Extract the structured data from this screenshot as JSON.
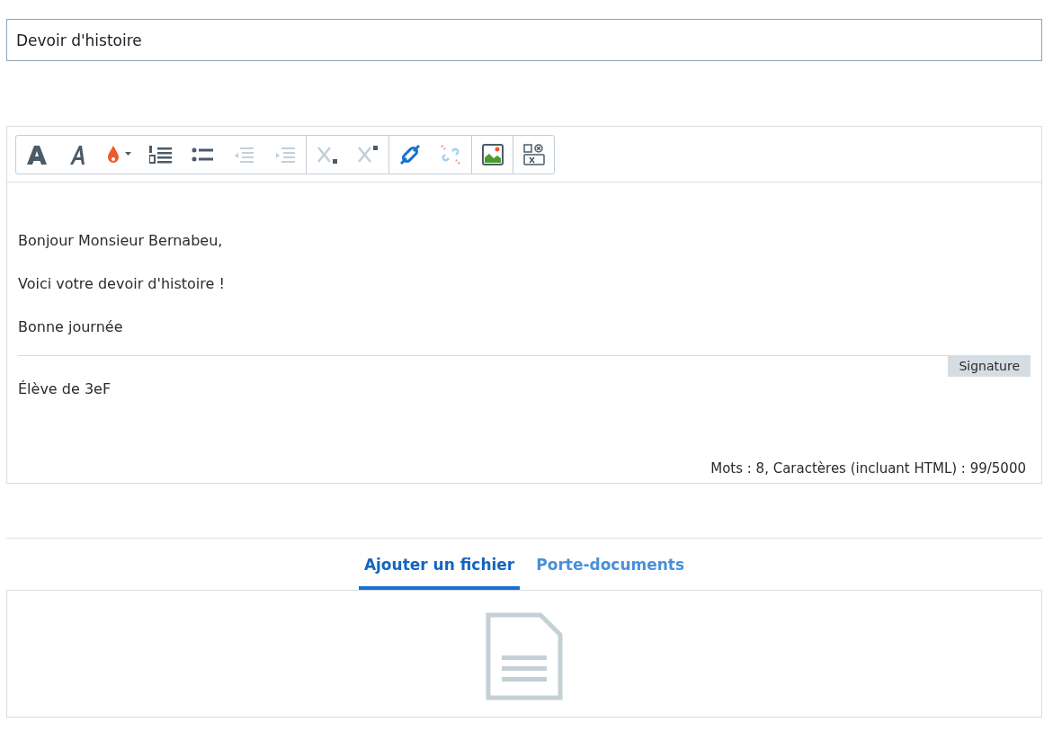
{
  "subject_field": {
    "value": "Devoir d'histoire"
  },
  "editor": {
    "toolbar": [
      {
        "kind": "bold",
        "disabled": false
      },
      {
        "kind": "italic",
        "disabled": false
      },
      {
        "kind": "color",
        "disabled": false
      },
      {
        "kind": "ordered-list",
        "disabled": false
      },
      {
        "kind": "bullet-list",
        "disabled": false
      },
      {
        "kind": "outdent",
        "disabled": true
      },
      {
        "kind": "indent",
        "disabled": true
      },
      {
        "kind": "subscript",
        "disabled": true
      },
      {
        "kind": "superscript",
        "disabled": true
      },
      {
        "kind": "link",
        "disabled": false
      },
      {
        "kind": "unlink",
        "disabled": true
      },
      {
        "kind": "image",
        "disabled": false
      },
      {
        "kind": "field",
        "disabled": false
      }
    ],
    "paragraphs": [
      "Bonjour Monsieur Bernabeu,",
      "Voici votre devoir d'histoire !",
      "Bonne journée"
    ],
    "signature_tag": "Signature",
    "signature": "Élève de 3eF",
    "counter": "Mots : 8, Caractères (incluant HTML) : 99/5000"
  },
  "attachment_tabs": [
    {
      "label": "Ajouter un fichier",
      "selected": true
    },
    {
      "label": "Porte-documents",
      "selected": false
    }
  ]
}
